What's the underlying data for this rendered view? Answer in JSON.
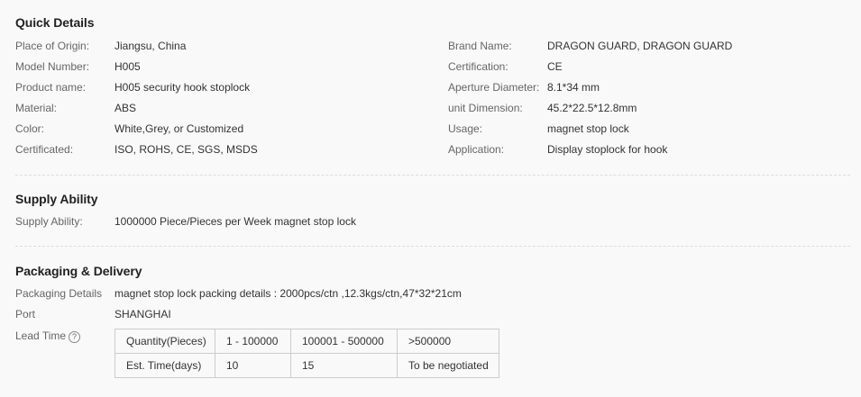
{
  "quick_details": {
    "heading": "Quick Details",
    "left": [
      {
        "label": "Place of Origin:",
        "value": "Jiangsu, China"
      },
      {
        "label": "Model Number:",
        "value": "H005"
      },
      {
        "label": "Product name:",
        "value": "H005 security hook stoplock"
      },
      {
        "label": "Material:",
        "value": "ABS"
      },
      {
        "label": "Color:",
        "value": "White,Grey, or Customized"
      },
      {
        "label": "Certificated:",
        "value": "ISO, ROHS, CE, SGS, MSDS"
      }
    ],
    "right": [
      {
        "label": "Brand Name:",
        "value": "DRAGON GUARD, DRAGON GUARD"
      },
      {
        "label": "Certification:",
        "value": "CE"
      },
      {
        "label": "Aperture Diameter:",
        "value": "8.1*34 mm"
      },
      {
        "label": "unit Dimension:",
        "value": "45.2*22.5*12.8mm"
      },
      {
        "label": "Usage:",
        "value": "magnet stop lock"
      },
      {
        "label": "Application:",
        "value": "Display stoplock for hook"
      }
    ]
  },
  "supply_ability": {
    "heading": "Supply Ability",
    "label": "Supply Ability:",
    "value": "1000000 Piece/Pieces per Week magnet stop lock"
  },
  "packaging": {
    "heading": "Packaging & Delivery",
    "details_label": "Packaging Details",
    "details_value": "magnet stop lock packing details : 2000pcs/ctn ,12.3kgs/ctn,47*32*21cm",
    "port_label": "Port",
    "port_value": "SHANGHAI",
    "lead_time_label": "Lead Time",
    "help_icon": "question-circle-icon",
    "lead_table": {
      "rows": [
        [
          "Quantity(Pieces)",
          "1 - 100000",
          "100001 - 500000",
          ">500000"
        ],
        [
          "Est. Time(days)",
          "10",
          "15",
          "To be negotiated"
        ]
      ]
    }
  }
}
